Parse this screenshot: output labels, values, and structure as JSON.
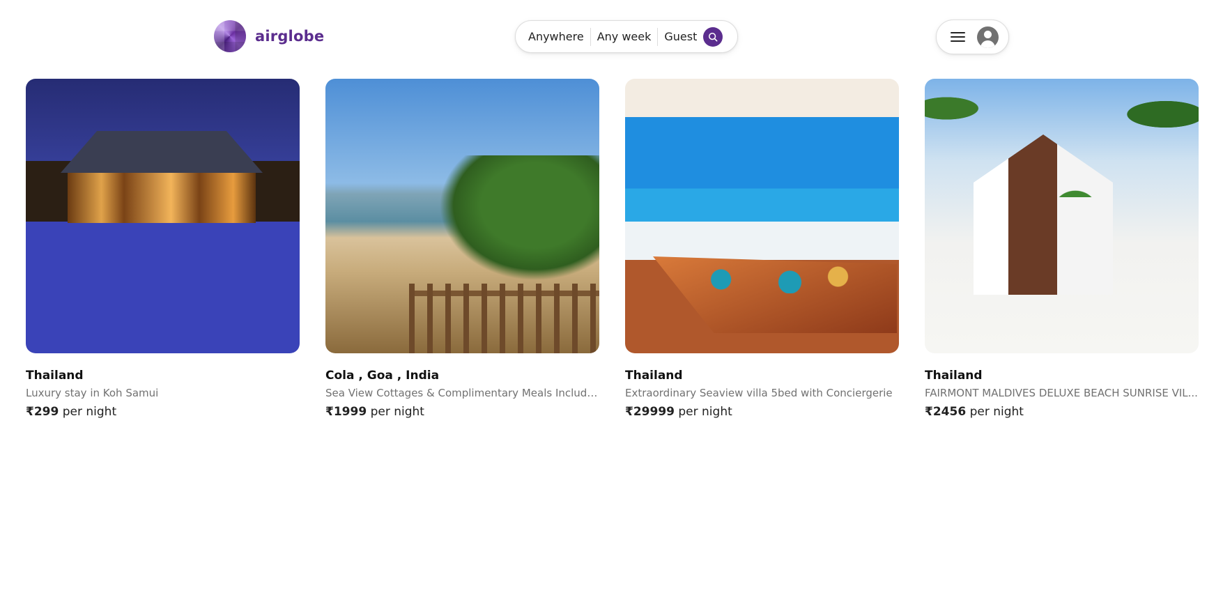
{
  "app": {
    "logo_text": "airglobe",
    "brand_color": "#5b2d8e"
  },
  "search": {
    "where": "Anywhere",
    "when": "Any week",
    "who": "Guest",
    "button_icon": "search-icon"
  },
  "user_menu": {
    "menu_icon": "hamburger-icon",
    "avatar_icon": "user-avatar-icon"
  },
  "listings": [
    {
      "title": "Thailand",
      "subtitle": "Luxury stay in Koh Samui",
      "price": "₹299",
      "price_suffix": "per night",
      "image": "villa-pool-night"
    },
    {
      "title": "Cola , Goa , India",
      "subtitle": "Sea View Cottages & Complimentary Meals Included",
      "price": "₹1999",
      "price_suffix": "per night",
      "image": "beach-palms-balcony"
    },
    {
      "title": "Thailand",
      "subtitle": "Extraordinary Seaview villa 5bed with Conciergerie",
      "price": "₹29999",
      "price_suffix": "per night",
      "image": "seaview-dining-terrace"
    },
    {
      "title": "Thailand",
      "subtitle": "FAIRMONT MALDIVES DELUXE BEACH SUNRISE VIL...",
      "price": "₹2456",
      "price_suffix": "per night",
      "image": "beach-villa-plunge-pool"
    }
  ]
}
